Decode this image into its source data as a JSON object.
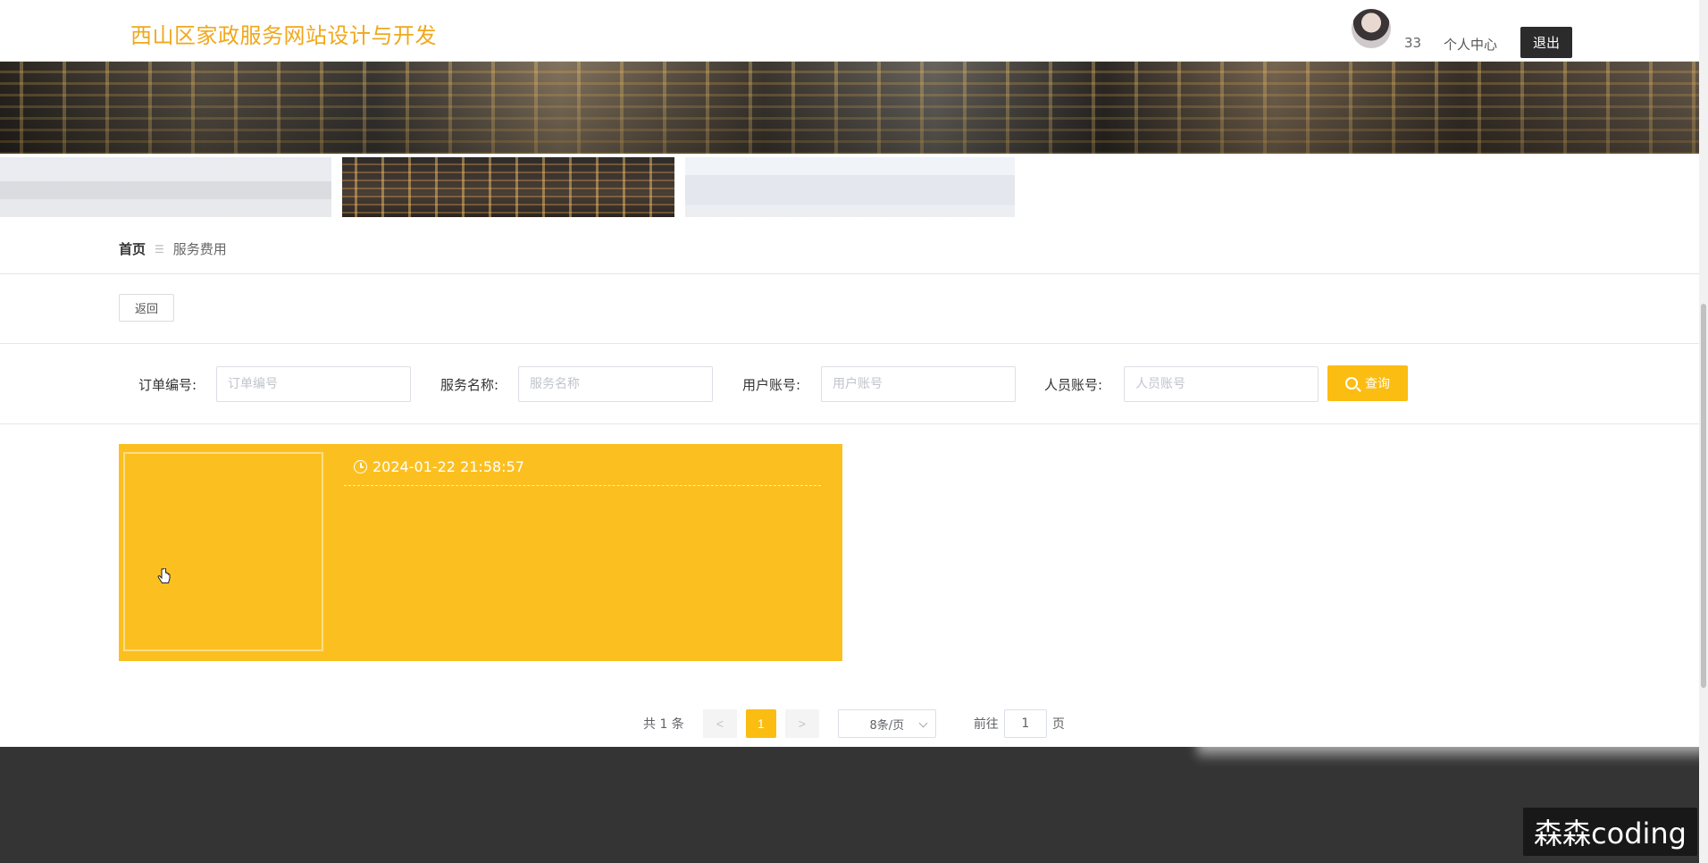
{
  "header": {
    "site_title": "西山区家政服务网站设计与开发",
    "username": "33",
    "profile_link": "个人中心",
    "logout_label": "退出"
  },
  "breadcrumb": {
    "home": "首页",
    "separator": "☰",
    "current": "服务费用"
  },
  "back_label": "返回",
  "search": {
    "fields": [
      {
        "label": "订单编号:",
        "placeholder": "订单编号",
        "value": ""
      },
      {
        "label": "服务名称:",
        "placeholder": "服务名称",
        "value": ""
      },
      {
        "label": "用户账号:",
        "placeholder": "用户账号",
        "value": ""
      },
      {
        "label": "人员账号:",
        "placeholder": "人员账号",
        "value": ""
      }
    ],
    "button_label": "查询"
  },
  "list": {
    "items": [
      {
        "time": "2024-01-22 21:58:57"
      }
    ]
  },
  "pagination": {
    "total_text": "共 1 条",
    "prev": "<",
    "current_page": "1",
    "next": ">",
    "page_size": "8条/页",
    "goto_label": "前往",
    "goto_value": "1",
    "goto_suffix": "页"
  },
  "watermark": "森森coding",
  "colors": {
    "accent": "#fbbd12",
    "title": "#f0a81d",
    "footer": "#343434"
  }
}
